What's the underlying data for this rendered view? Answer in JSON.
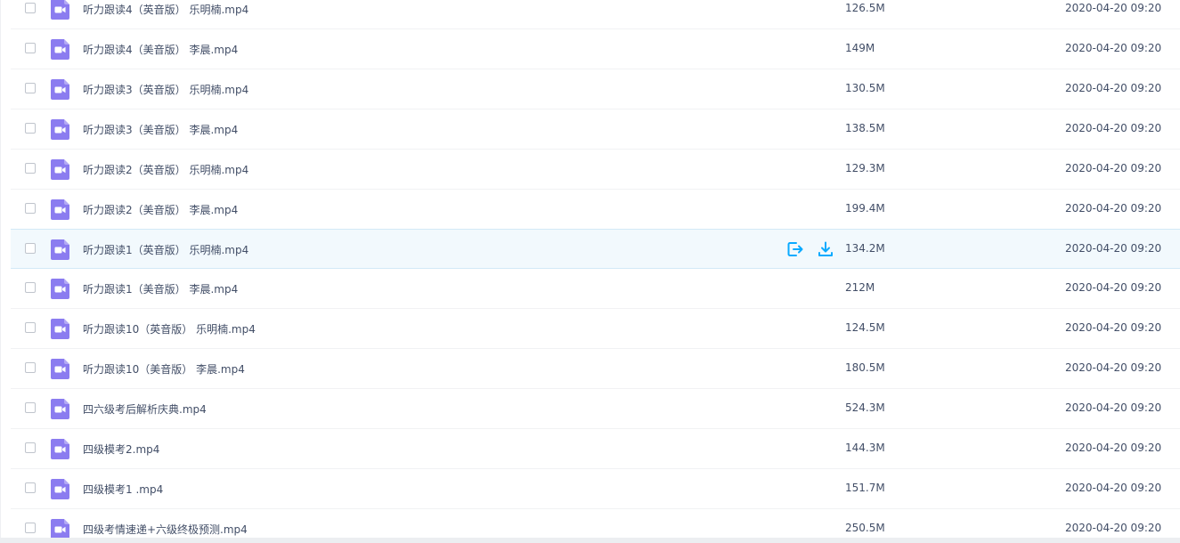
{
  "colors": {
    "file_icon": "#8b7cf0",
    "accent": "#09aaff",
    "text": "#424e67",
    "row_hover": "#f2f9fd"
  },
  "row_actions": {
    "share_icon": "share-icon",
    "download_icon": "download-icon"
  },
  "files": [
    {
      "name": "听力跟读4（英音版） 乐明楠.mp4",
      "size": "126.5M",
      "date": "2020-04-20 09:20",
      "icon": "video-file-icon",
      "hover": false
    },
    {
      "name": "听力跟读4（美音版） 李晨.mp4",
      "size": "149M",
      "date": "2020-04-20 09:20",
      "icon": "video-file-icon",
      "hover": false
    },
    {
      "name": "听力跟读3（英音版） 乐明楠.mp4",
      "size": "130.5M",
      "date": "2020-04-20 09:20",
      "icon": "video-file-icon",
      "hover": false
    },
    {
      "name": "听力跟读3（美音版） 李晨.mp4",
      "size": "138.5M",
      "date": "2020-04-20 09:20",
      "icon": "video-file-icon",
      "hover": false
    },
    {
      "name": "听力跟读2（英音版） 乐明楠.mp4",
      "size": "129.3M",
      "date": "2020-04-20 09:20",
      "icon": "video-file-icon",
      "hover": false
    },
    {
      "name": "听力跟读2（美音版） 李晨.mp4",
      "size": "199.4M",
      "date": "2020-04-20 09:20",
      "icon": "video-file-icon",
      "hover": false
    },
    {
      "name": "听力跟读1（英音版） 乐明楠.mp4",
      "size": "134.2M",
      "date": "2020-04-20 09:20",
      "icon": "video-file-icon",
      "hover": true
    },
    {
      "name": "听力跟读1（美音版） 李晨.mp4",
      "size": "212M",
      "date": "2020-04-20 09:20",
      "icon": "video-file-icon",
      "hover": false
    },
    {
      "name": "听力跟读10（英音版） 乐明楠.mp4",
      "size": "124.5M",
      "date": "2020-04-20 09:20",
      "icon": "video-file-icon",
      "hover": false
    },
    {
      "name": "听力跟读10（美音版） 李晨.mp4",
      "size": "180.5M",
      "date": "2020-04-20 09:20",
      "icon": "video-file-icon",
      "hover": false
    },
    {
      "name": "四六级考后解析庆典.mp4",
      "size": "524.3M",
      "date": "2020-04-20 09:20",
      "icon": "video-file-icon",
      "hover": false
    },
    {
      "name": "四级模考2.mp4",
      "size": "144.3M",
      "date": "2020-04-20 09:20",
      "icon": "video-file-icon",
      "hover": false
    },
    {
      "name": "四级模考1 .mp4",
      "size": "151.7M",
      "date": "2020-04-20 09:20",
      "icon": "video-file-icon",
      "hover": false
    },
    {
      "name": "四级考情速递+六级终极预测.mp4",
      "size": "250.5M",
      "date": "2020-04-20 09:20",
      "icon": "video-file-icon",
      "hover": false
    }
  ]
}
